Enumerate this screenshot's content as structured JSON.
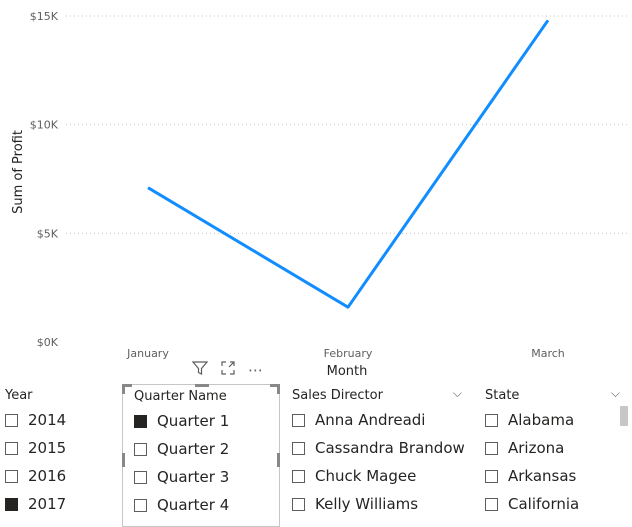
{
  "chart_data": {
    "type": "line",
    "categories": [
      "January",
      "February",
      "March"
    ],
    "series": [
      {
        "values": [
          7100,
          1600,
          14800
        ]
      }
    ],
    "xlabel": "Month",
    "ylabel": "Sum of Profit",
    "yticks": [
      "$0K",
      "$5K",
      "$10K",
      "$15K"
    ],
    "ytick_values": [
      0,
      5000,
      10000,
      15000
    ],
    "ylim": [
      0,
      15000
    ],
    "grid": true,
    "line_color": "#118DFF"
  },
  "visual_toolbar": {
    "filter_icon": "filter-icon",
    "focus_icon": "focus-mode-icon",
    "more_label": "⋯"
  },
  "slicers": {
    "year": {
      "title": "Year",
      "items": [
        {
          "label": "2014",
          "checked": false
        },
        {
          "label": "2015",
          "checked": false
        },
        {
          "label": "2016",
          "checked": false
        },
        {
          "label": "2017",
          "checked": true
        }
      ]
    },
    "quarter": {
      "title": "Quarter Name",
      "items": [
        {
          "label": "Quarter 1",
          "checked": true
        },
        {
          "label": "Quarter 2",
          "checked": false
        },
        {
          "label": "Quarter 3",
          "checked": false
        },
        {
          "label": "Quarter 4",
          "checked": false
        }
      ]
    },
    "director": {
      "title": "Sales Director",
      "items": [
        {
          "label": "Anna Andreadi",
          "checked": false
        },
        {
          "label": "Cassandra Brandow",
          "checked": false
        },
        {
          "label": "Chuck Magee",
          "checked": false
        },
        {
          "label": "Kelly Williams",
          "checked": false
        }
      ]
    },
    "state": {
      "title": "State",
      "items": [
        {
          "label": "Alabama",
          "checked": false
        },
        {
          "label": "Arizona",
          "checked": false
        },
        {
          "label": "Arkansas",
          "checked": false
        },
        {
          "label": "California",
          "checked": false
        }
      ]
    }
  },
  "chevron_glyph": "⌵"
}
